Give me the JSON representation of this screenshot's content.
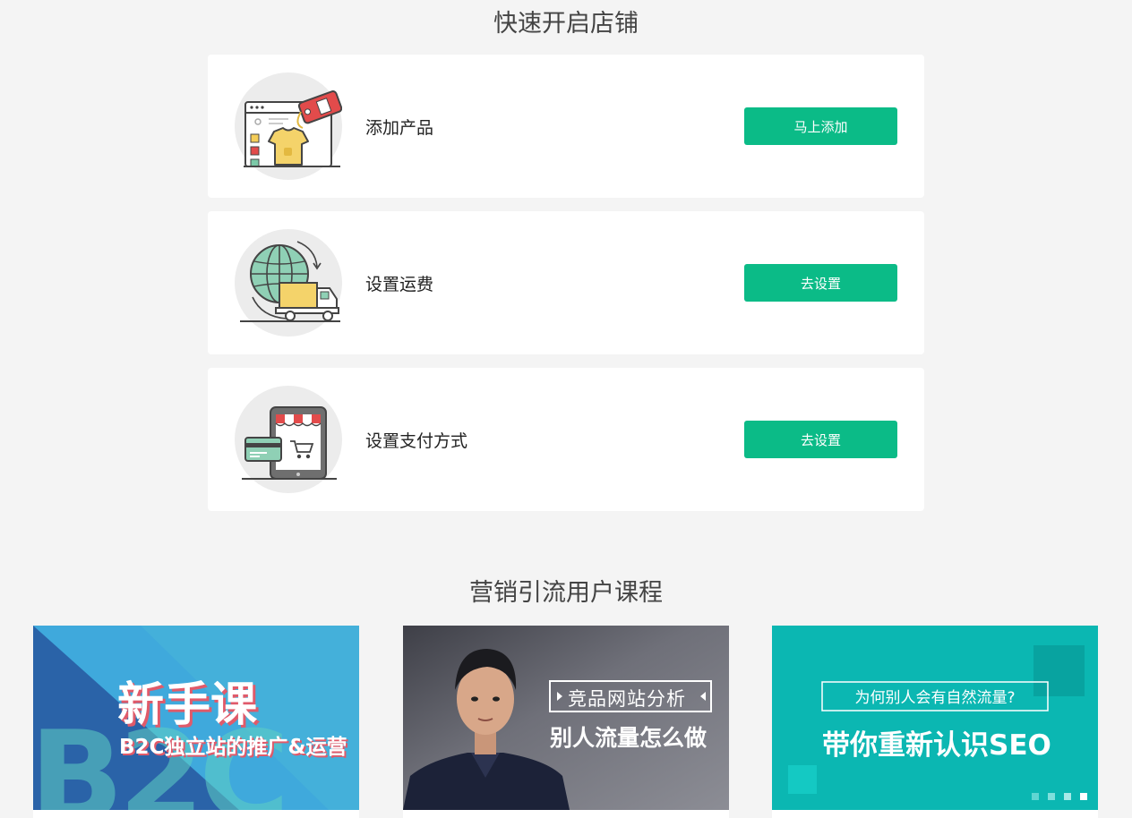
{
  "quick_start": {
    "title": "快速开启店铺",
    "steps": [
      {
        "label": "添加产品",
        "button": "马上添加",
        "icon": "product-tag-icon"
      },
      {
        "label": "设置运费",
        "button": "去设置",
        "icon": "shipping-globe-icon"
      },
      {
        "label": "设置支付方式",
        "button": "去设置",
        "icon": "payment-shop-icon"
      }
    ]
  },
  "courses": {
    "title": "营销引流用户课程",
    "items": [
      {
        "headline": "新手课",
        "subline": "B2C独立站的推广&运营",
        "watermark": "B2C"
      },
      {
        "tag": "竞品网站分析",
        "headline": "别人流量怎么做"
      },
      {
        "tag": "为何别人会有自然流量?",
        "headline": "带你重新认识SEO"
      }
    ]
  },
  "colors": {
    "accent": "#0bbb87",
    "background": "#f4f4f4",
    "teal": "#0bb7b2"
  }
}
